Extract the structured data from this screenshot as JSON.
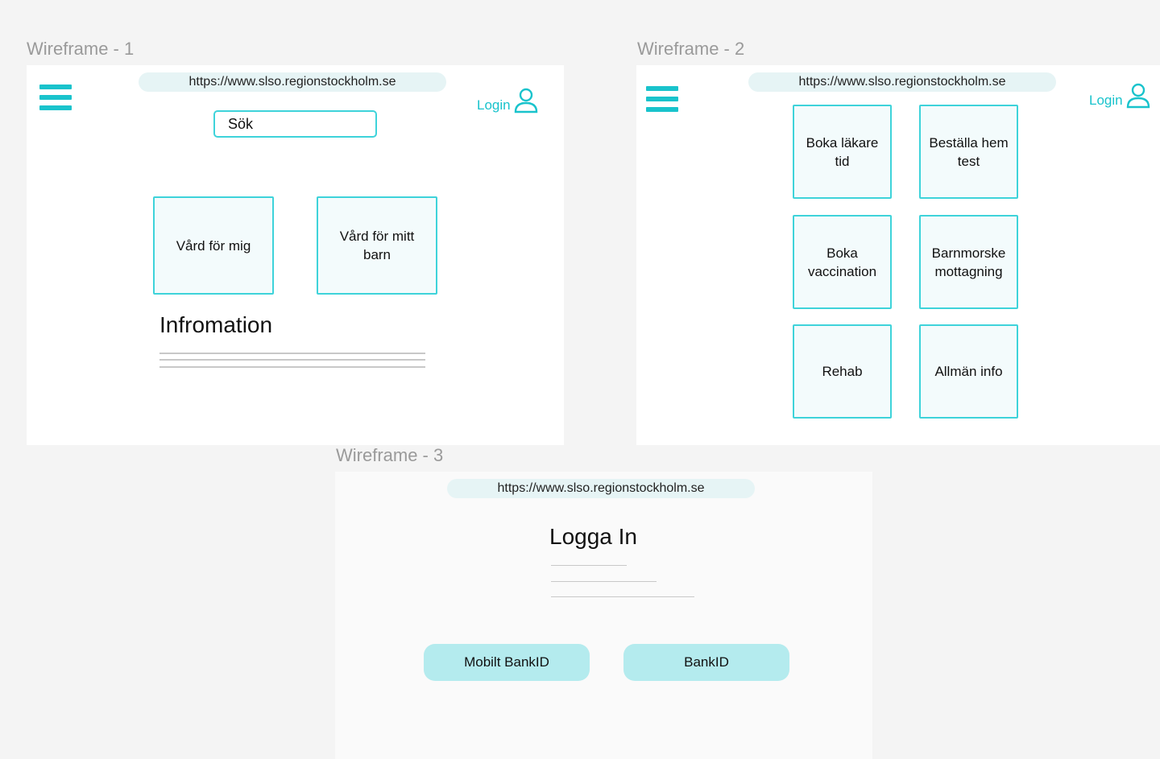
{
  "wireframe1": {
    "label": "Wireframe - 1",
    "url": "https://www.slso.regionstockholm.se",
    "login_label": "Login",
    "search_placeholder": "Sök",
    "tiles": [
      "Vård för mig",
      "Vård för mitt barn"
    ],
    "info_heading": "Infromation"
  },
  "wireframe2": {
    "label": "Wireframe - 2",
    "url": "https://www.slso.regionstockholm.se",
    "login_label": "Login",
    "tiles": [
      "Boka läkare tid",
      "Beställa hem test",
      "Boka vaccination",
      "Barnmorske mottagning",
      "Rehab",
      "Allmän info"
    ]
  },
  "wireframe3": {
    "label": "Wireframe - 3",
    "url": "https://www.slso.regionstockholm.se",
    "title": "Logga In",
    "buttons": [
      "Mobilt BankID",
      "BankID"
    ]
  },
  "colors": {
    "accent": "#19c3cc",
    "tile_border": "#3ed3da",
    "button": "#b4ebee"
  },
  "icons": {
    "menu": "hamburger-menu-icon",
    "user": "user-icon"
  }
}
